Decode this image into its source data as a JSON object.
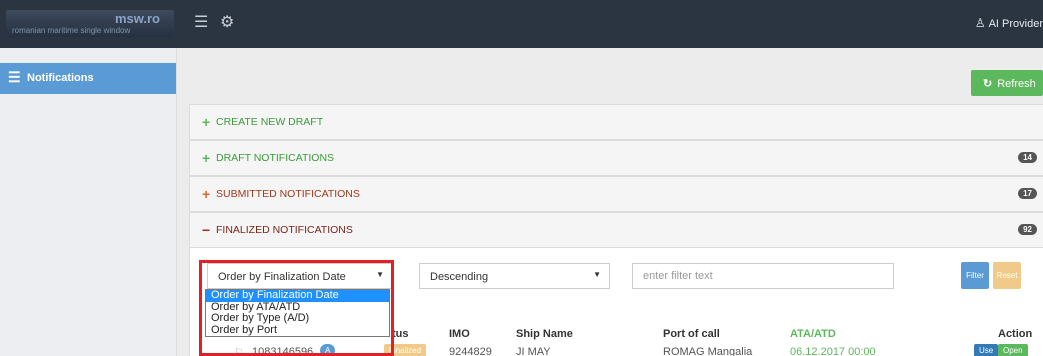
{
  "header": {
    "brand": "msw.ro",
    "tagline": "romanian maritime single window",
    "menu_icon": "hamburger-menu-icon",
    "settings_icon": "gear-icon",
    "user_icon": "user-icon",
    "user_name": "AI Provider"
  },
  "sidebar": {
    "items": [
      {
        "label": "Notifications",
        "icon": "list-icon",
        "active": true
      }
    ]
  },
  "toolbar": {
    "refresh_label": "Refresh",
    "refresh_icon": "refresh-icon"
  },
  "panels": [
    {
      "sign": "+",
      "title": "CREATE NEW DRAFT",
      "badge": ""
    },
    {
      "sign": "+",
      "title": "DRAFT NOTIFICATIONS",
      "badge": "14"
    },
    {
      "sign": "+",
      "title": "SUBMITTED NOTIFICATIONS",
      "badge": "17"
    },
    {
      "sign": "−",
      "title": "FINALIZED NOTIFICATIONS",
      "badge": "92"
    }
  ],
  "filters": {
    "order_by_selected": "Order by Finalization Date",
    "order_by_options": [
      "Order by Finalization Date",
      "Order by ATA/ATD",
      "Order by Type (A/D)",
      "Order by Port"
    ],
    "direction_selected": "Descending",
    "filter_placeholder": "enter filter text",
    "filter_button": "Filter",
    "reset_button": "Reset"
  },
  "table": {
    "headers": {
      "status": "tus",
      "imo": "IMO",
      "ship_name": "Ship Name",
      "port": "Port of call",
      "ata": "ATA",
      "atd": "ATD",
      "action": "Action"
    },
    "rows": [
      {
        "id": "1083146596",
        "type": "A",
        "status": "Finalized",
        "imo": "9244829",
        "ship_name": "JI MAY",
        "port": "ROMAG  Mangalia",
        "date": "06.12.2017 00:00",
        "use": "Use",
        "open": "Open"
      }
    ]
  },
  "colors": {
    "topbar": "#2b3541",
    "sidebar_active": "#5b9bd5",
    "refresh": "#5cb85c",
    "highlight_box": "#e3202a",
    "dropdown_selected": "#1e90ff"
  }
}
